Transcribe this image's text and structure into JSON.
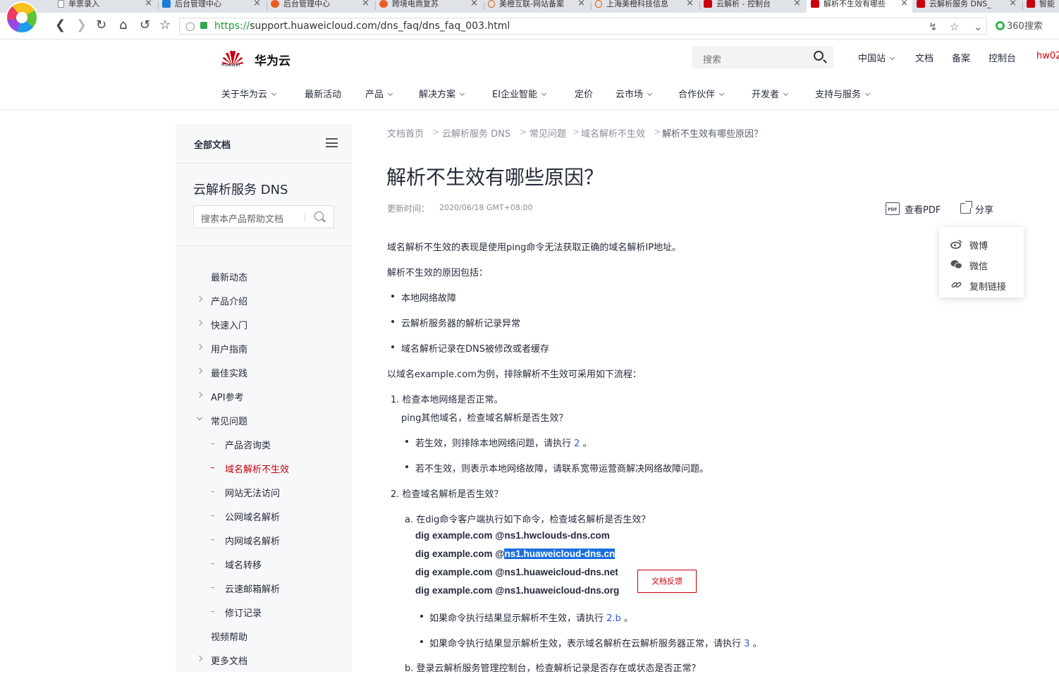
{
  "browser": {
    "tabs": [
      {
        "label": "单票录入",
        "active": false
      },
      {
        "label": "后台管理中心",
        "active": false
      },
      {
        "label": "后台管理中心",
        "active": false
      },
      {
        "label": "跨境电商复苏",
        "active": false
      },
      {
        "label": "美橙互联-网站备案",
        "active": false
      },
      {
        "label": "上海美橙科技信息",
        "active": false
      },
      {
        "label": "云解析 - 控制台",
        "active": false
      },
      {
        "label": "解析不生效有哪些",
        "active": true
      },
      {
        "label": "云解析服务 DNS_",
        "active": false
      },
      {
        "label": "智能",
        "active": false
      }
    ],
    "url_scheme": "https://",
    "url_rest": "support.huaweicloud.com/dns_faq/dns_faq_003.html",
    "search_engine": "360搜索"
  },
  "site": {
    "brand_word": "HUAWEI",
    "brand_name": "华为云",
    "search_placeholder": "搜索",
    "top_links": [
      "中国站",
      "文档",
      "备案",
      "控制台",
      "hw02"
    ],
    "main_nav": [
      "关于华为云",
      "最新活动",
      "产品",
      "解决方案",
      "EI企业智能",
      "定价",
      "云市场",
      "合作伙伴",
      "开发者",
      "支持与服务"
    ]
  },
  "sidebar": {
    "all_docs": "全部文档",
    "product_title": "云解析服务 DNS",
    "search_placeholder": "搜索本产品帮助文档",
    "items": [
      "最新动态",
      "产品介绍",
      "快速入门",
      "用户指南",
      "最佳实践",
      "API参考",
      "常见问题"
    ],
    "faq_children": [
      "产品咨询类",
      "域名解析不生效",
      "网站无法访问",
      "公网域名解析",
      "内网域名解析",
      "域名转移",
      "云速邮箱解析",
      "修订记录"
    ],
    "tail_items": [
      "视频帮助",
      "更多文档"
    ]
  },
  "breadcrumb": [
    "文档首页",
    "云解析服务 DNS",
    "常见问题",
    "域名解析不生效",
    "解析不生效有哪些原因？"
  ],
  "article": {
    "title": "解析不生效有哪些原因？",
    "updated_label": "更新时间：",
    "updated_date": "2020/06/18 GMT+08:00",
    "pdf_label": "查看PDF",
    "share_label": "分享",
    "share_menu": [
      "微博",
      "微信",
      "复制链接"
    ],
    "intro": "域名解析不生效的表现是使用ping命令无法获取正确的域名解析IP地址。",
    "reasons_title": "解析不生效的原因包括：",
    "reasons": [
      "本地网络故障",
      "云解析服务器的解析记录异常",
      "域名解析记录在DNS被修改或者缓存"
    ],
    "flow_intro": "以域名example.com为例，排除解析不生效可采用如下流程：",
    "step1_title": "1. 检查本地网络是否正常。",
    "step1_desc": "ping其他域名，检查域名解析是否生效？",
    "step1_b1_pre": "若生效，则排除本地网络问题，请执行",
    "step1_b1_link": "2",
    "step1_b1_post": "。",
    "step1_b2": "若不生效，则表示本地网络故障，请联系宽带运营商解决网络故障问题。",
    "step2_title": "2. 检查域名解析是否生效？",
    "step2a": "a. 在dig命令客户端执行如下命令，检查域名解析是否生效？",
    "commands": {
      "c1": "dig example.com @ns1.hwclouds-dns.com",
      "c2_pre": "dig example.com @",
      "c2_sel": "ns1.huaweicloud-dns.cn",
      "c3": "dig example.com @ns1.huaweicloud-dns.net",
      "c4": "dig example.com @ns1.huaweicloud-dns.org"
    },
    "step2_b1_pre": "如果命令执行结果显示解析不生效，请执行",
    "step2_b1_link": "2.b",
    "step2_b1_post": "。",
    "step2_b2_pre": "如果命令执行结果显示解析生效，表示域名解析在云解析服务器正常，请执行",
    "step2_b2_link": "3",
    "step2_b2_post": "。",
    "step2b": "b. 登录云解析服务管理控制台，检查解析记录是否存在或状态是否正常？",
    "feedback": "文档反馈"
  },
  "colors": {
    "brand_red": "#c7000b",
    "link_blue": "#2a5bd7",
    "selection": "#1a6fe0"
  }
}
